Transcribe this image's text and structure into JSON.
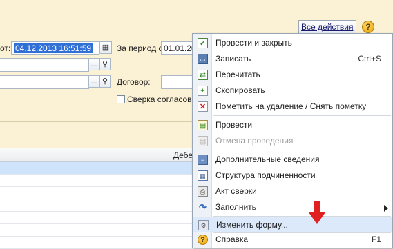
{
  "toolbar": {
    "all_actions": "Все действия",
    "help": "?"
  },
  "form": {
    "from_label": "от:",
    "from_value": "04.12.2013 16:51:59",
    "period_label": "За период с:",
    "period_value": "01.01.20",
    "contract_label": "Договор:",
    "reconciliation_label": "Сверка согласова",
    "ellipsis": "...",
    "search_glyph": "⚲"
  },
  "grid": {
    "col2_header": "Дебе"
  },
  "menu": {
    "items": [
      {
        "label": "Провести и закрыть",
        "shortcut": "",
        "icon": "post-close-icon"
      },
      {
        "label": "Записать",
        "shortcut": "Ctrl+S",
        "icon": "save-icon"
      },
      {
        "label": "Перечитать",
        "shortcut": "",
        "icon": "reread-icon"
      },
      {
        "label": "Скопировать",
        "shortcut": "",
        "icon": "copy-icon"
      },
      {
        "label": "Пометить на удаление / Снять пометку",
        "shortcut": "",
        "icon": "delete-mark-icon"
      },
      {
        "label": "Провести",
        "shortcut": "",
        "icon": "post-icon"
      },
      {
        "label": "Отмена проведения",
        "shortcut": "",
        "icon": "cancel-post-icon"
      },
      {
        "label": "Дополнительные сведения",
        "shortcut": "",
        "icon": "additional-info-icon"
      },
      {
        "label": "Структура подчиненности",
        "shortcut": "",
        "icon": "structure-icon"
      },
      {
        "label": "Акт сверки",
        "shortcut": "",
        "icon": "print-icon"
      },
      {
        "label": "Заполнить",
        "shortcut": "",
        "icon": "fill-icon"
      },
      {
        "label": "Изменить форму...",
        "shortcut": "",
        "icon": "change-form-icon"
      },
      {
        "label": "Справка",
        "shortcut": "F1",
        "icon": "help-icon"
      }
    ]
  },
  "colors": {
    "accent": "#2f6fd6",
    "background": "#fbf1d5",
    "hover": "#dbe9fb",
    "arrow": "#e02020"
  }
}
